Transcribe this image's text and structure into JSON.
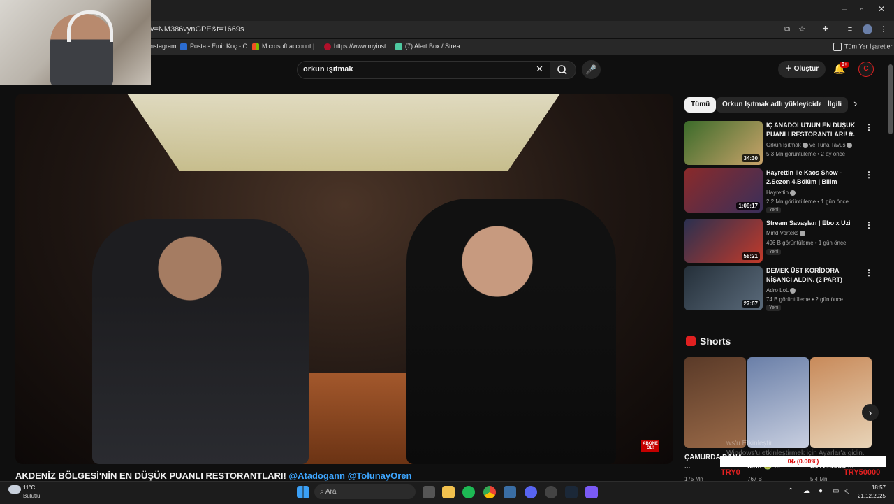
{
  "browser": {
    "url": "v=NM386vynGPE&t=1669s",
    "bookmarks": [
      "nstagram",
      "Posta - Emir Koç - O...",
      "Microsoft account |...",
      "https://www.myinst...",
      "(7) Alert Box / Strea...",
      "Tüm Yer İşaretleri"
    ],
    "window_controls": [
      "–",
      "▫",
      "✕"
    ]
  },
  "youtube": {
    "search_value": "orkun ışıtmak",
    "create_label": "Oluştur",
    "notif_count": "9+",
    "avatar_letter": "C"
  },
  "video": {
    "title_main": "AKDENİZ BÖLGESİ'NİN EN DÜŞÜK PUANLI RESTORANTLARI!",
    "title_tags": " @Atadogann @TolunayOren",
    "overlay_text": "ABONE OL!"
  },
  "chips": [
    "Tümü",
    "Orkun Işıtmak adlı yükleyiciden",
    "İlgili"
  ],
  "recommendations": [
    {
      "title": "İÇ ANADOLU'NUN EN DÜŞÜK PUANLI RESTORANTLARI! ft. ...",
      "channel": "Orkun Işıtmak",
      "collab": "ve Tuna Tavus",
      "meta": "5,3 Mn görüntüleme • 2 ay önce",
      "duration": "34:30",
      "badge": "",
      "color_a": "#3b6b2a",
      "color_b": "#c9a36a"
    },
    {
      "title": "Hayrettin ile Kaos Show - 2.Sezon 4.Bölüm | Bilim Kurgu...",
      "channel": "Hayrettin",
      "collab": "",
      "meta": "2,2 Mn görüntüleme • 1 gün önce",
      "duration": "1:09:17",
      "badge": "Yeni",
      "color_a": "#8a2a2a",
      "color_b": "#3a2f5a"
    },
    {
      "title": "Stream Savaşları | Ebo x Uzi",
      "channel": "Mind Vorteks",
      "collab": "",
      "meta": "496 B görüntüleme • 1 gün önce",
      "duration": "58:21",
      "badge": "Yeni",
      "color_a": "#2a3050",
      "color_b": "#c23a2a"
    },
    {
      "title": "DEMEK ÜST KORİDORA NİŞANCI ALDIN. (2 PART)",
      "channel": "Adro LoL",
      "collab": "",
      "meta": "74 B görüntüleme • 2 gün önce",
      "duration": "27:07",
      "badge": "Yeni",
      "color_a": "#25303a",
      "color_b": "#5a6a7a"
    }
  ],
  "shorts": {
    "heading": "Shorts",
    "items": [
      {
        "title": "ÇAMURDA DANA ...",
        "views": "175 Mn",
        "color_a": "#5a3a28",
        "color_b": "#9a6a48"
      },
      {
        "title": "testi 🤢 ...",
        "views": "767 B",
        "color_a": "#6a7fa8",
        "color_b": "#c8cfe0"
      },
      {
        "title": "lezzetlerini ...",
        "views": "5,4 Mn",
        "color_a": "#c88a5a",
        "color_b": "#e8d4b8"
      }
    ]
  },
  "overlay": {
    "watermark_line1": "ws'u Etkinleştir",
    "watermark_line2": "Windows'u etkinleştirmek için Ayarlar'a gidin.",
    "donation": "0₺ (0.00%)",
    "try_left": "TRY0",
    "try_right": "TRY50000"
  },
  "taskbar": {
    "weather_temp": "11°C",
    "weather_desc": "Bulutlu",
    "search_placeholder": "Ara",
    "time": "18:57",
    "date": "21.12.2025"
  }
}
